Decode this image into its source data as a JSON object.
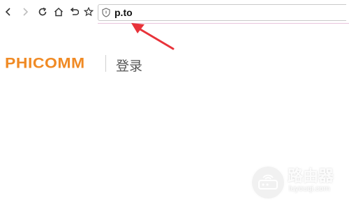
{
  "browser": {
    "url": "p.to",
    "icons": [
      "back-icon",
      "forward-icon",
      "reload-icon",
      "home-icon",
      "undo-icon",
      "star-icon",
      "shield-icon"
    ]
  },
  "page": {
    "brand": "PHICOMM",
    "title": "登录"
  },
  "watermark": {
    "name": "路由器",
    "url": "luyouqi.com"
  },
  "colors": {
    "brand": "#f08a24",
    "arrow": "#e8333a",
    "toolbar_line": "#e8c4dc"
  }
}
